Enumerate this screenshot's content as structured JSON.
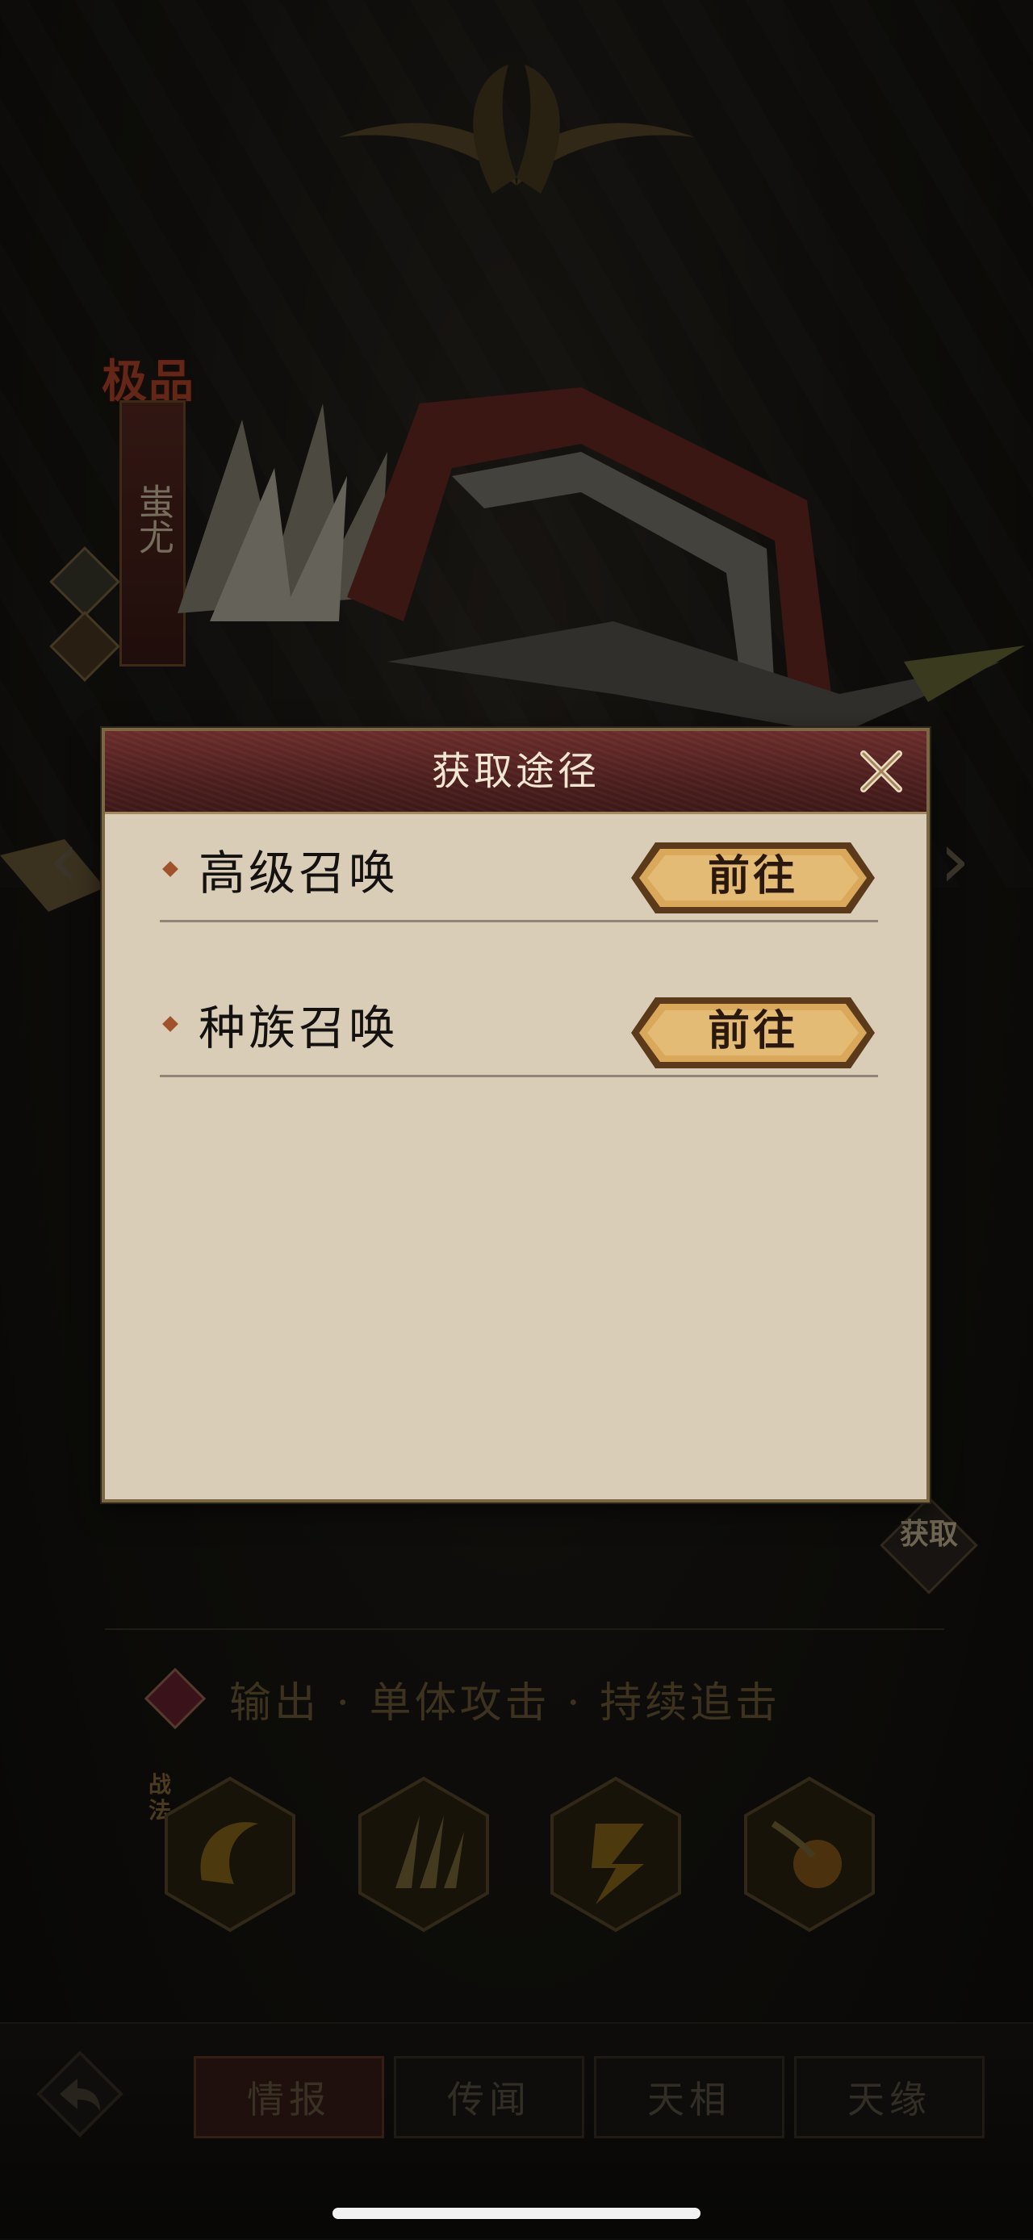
{
  "background": {
    "grade": "极品",
    "hero_name": "蚩尤",
    "get_badge": "获取",
    "role_description": "输出 · 单体攻击 · 持续追击",
    "skill_tag": "战法",
    "skills": [
      {
        "icon": "crescent-slash-icon"
      },
      {
        "icon": "claw-strike-icon"
      },
      {
        "icon": "lightning-icon"
      },
      {
        "icon": "comet-icon"
      }
    ],
    "tabs": [
      {
        "label": "情报",
        "active": true
      },
      {
        "label": "传闻",
        "active": false
      },
      {
        "label": "天相",
        "active": false
      },
      {
        "label": "天缘",
        "active": false
      }
    ]
  },
  "modal": {
    "title": "获取途径",
    "rows": [
      {
        "label": "高级召唤",
        "button": "前往"
      },
      {
        "label": "种族召唤",
        "button": "前往"
      }
    ]
  },
  "colors": {
    "modal_bg": "#d9cdb8",
    "header_bg": "#4c1f1e",
    "button_gold": "#d9a85a",
    "accent_red": "#b5452b"
  }
}
